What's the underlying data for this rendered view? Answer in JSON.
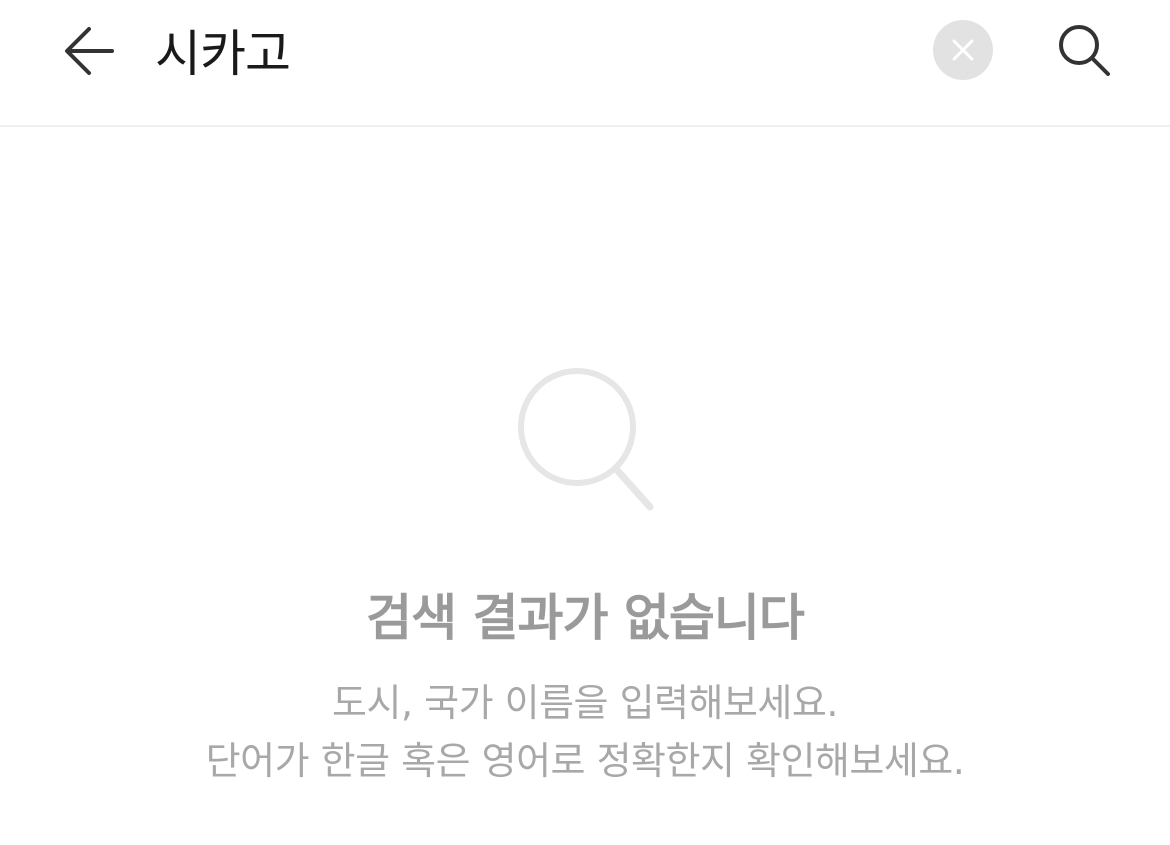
{
  "search": {
    "query": "시카고",
    "back_icon": "arrow-left-icon",
    "clear_icon": "close-icon",
    "submit_icon": "search-icon"
  },
  "empty_state": {
    "icon": "search-icon",
    "title": "검색 결과가 없습니다",
    "line1": "도시, 국가 이름을 입력해보세요.",
    "line2": "단어가 한글 혹은 영어로 정확한지 확인해보세요."
  },
  "colors": {
    "text_primary": "#1a1a1a",
    "text_muted": "#9a9a9a",
    "clear_bg": "#e2e2e2",
    "divider": "#efefef"
  }
}
